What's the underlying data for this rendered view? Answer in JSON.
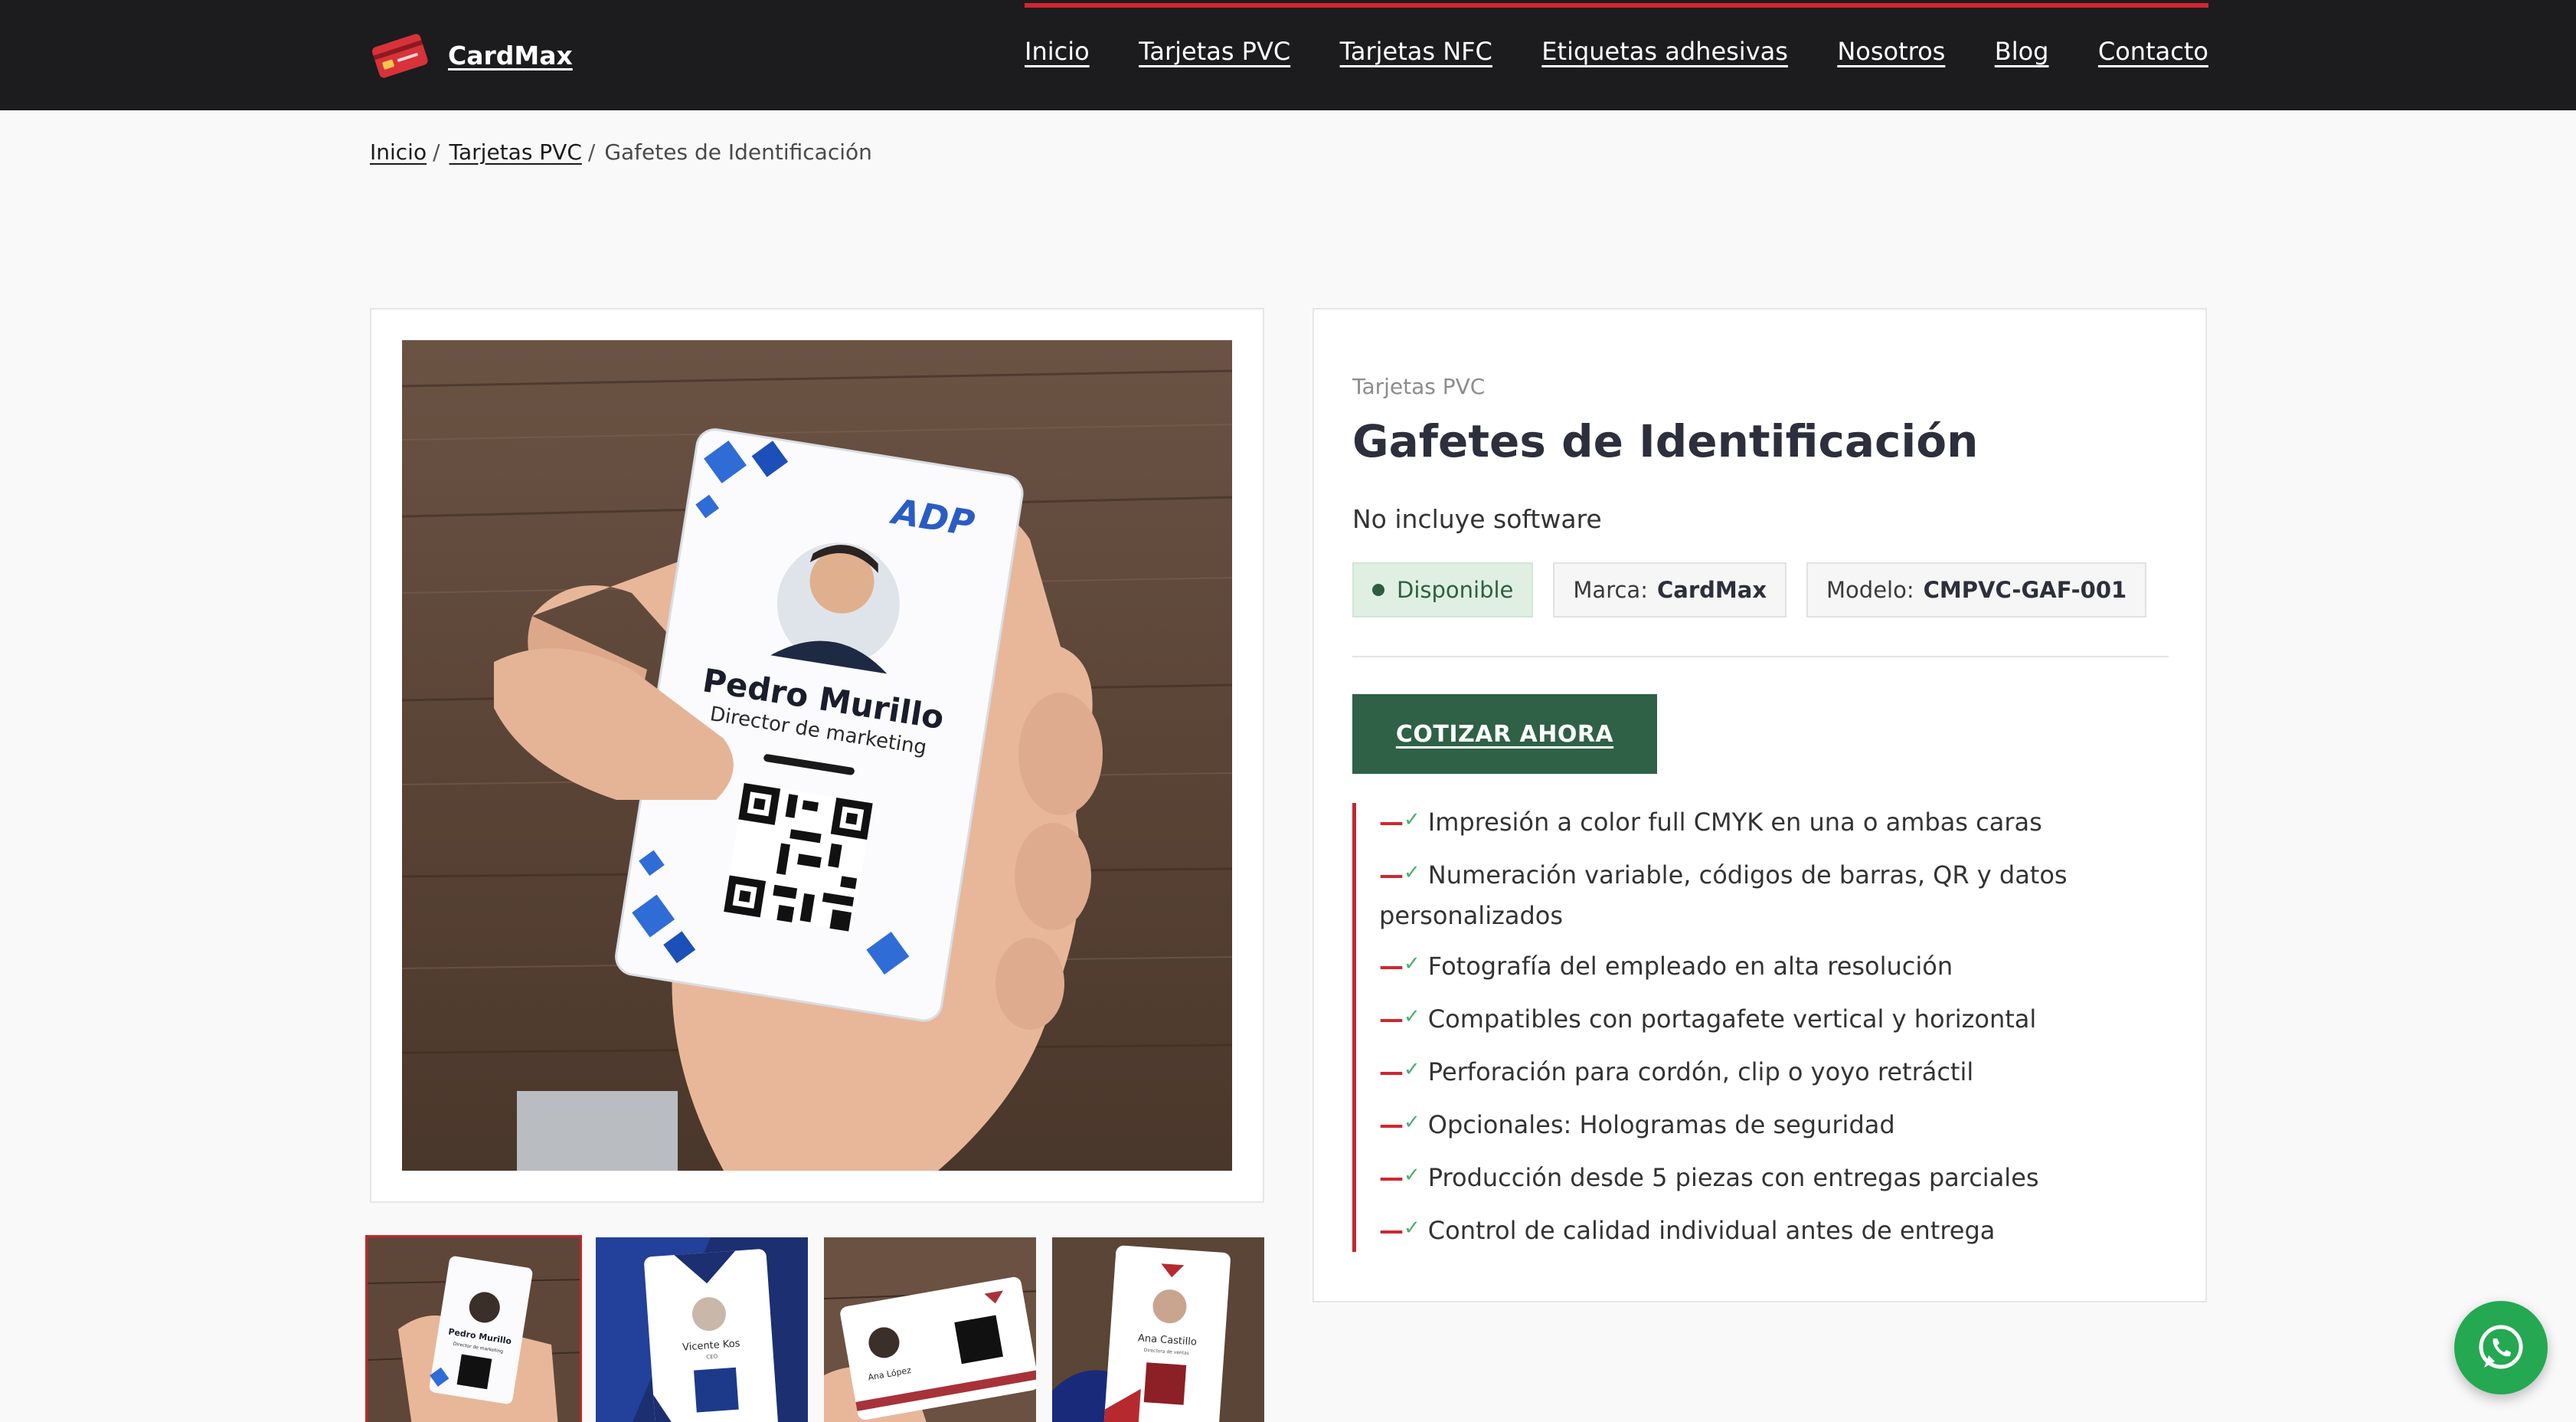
{
  "header": {
    "brand_name": "CardMax",
    "logo_icon": "id-card-logo",
    "nav": [
      "Inicio",
      "Tarjetas PVC",
      "Tarjetas NFC",
      "Etiquetas adhesivas",
      "Nosotros",
      "Blog",
      "Contacto"
    ],
    "accent_color": "#d22630"
  },
  "breadcrumb": {
    "items": [
      "Inicio",
      "Tarjetas PVC"
    ],
    "separator": "/",
    "current": "Gafetes de Identificación"
  },
  "gallery": {
    "main_card": {
      "logo": "ADP",
      "name": "Pedro Murillo",
      "role": "Director de marketing"
    },
    "thumbnails": [
      {
        "name": "Pedro Murillo",
        "role": "Director de marketing",
        "active": true
      },
      {
        "name": "Vicente Kos",
        "role": "CEO",
        "active": false
      },
      {
        "name": "Ana López",
        "role": "",
        "active": false
      },
      {
        "name": "Ana Castillo",
        "role": "Directora de ventas",
        "active": false
      }
    ]
  },
  "product": {
    "category": "Tarjetas PVC",
    "title": "Gafetes de Identificación",
    "note": "No incluye software",
    "availability": "Disponible",
    "brand_label": "Marca:",
    "brand_value": "CardMax",
    "model_label": "Modelo:",
    "model_value": "CMPVC-GAF-001",
    "cta_label": "COTIZAR AHORA",
    "cta_color": "#2e6146",
    "features": [
      "Impresión a color full CMYK en una o ambas caras",
      "Numeración variable, códigos de barras, QR y datos personalizados",
      "Fotografía del empleado en alta resolución",
      "Compatibles con portagafete vertical y horizontal",
      "Perforación para cordón, clip o yoyo retráctil",
      "Opcionales: Hologramas de seguridad",
      "Producción desde 5 piezas con entregas parciales",
      "Control de calidad individual antes de entrega"
    ],
    "feature_dash": "—",
    "feature_check": "✓"
  },
  "whatsapp": {
    "icon": "whatsapp-icon",
    "color": "#25a852"
  }
}
